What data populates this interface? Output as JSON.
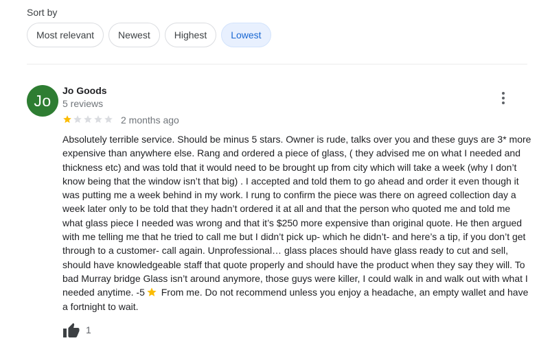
{
  "sort": {
    "label": "Sort by",
    "options": [
      "Most relevant",
      "Newest",
      "Highest",
      "Lowest"
    ],
    "selected": "Lowest"
  },
  "review": {
    "avatar_initials": "Jo",
    "author": "Jo Goods",
    "review_count": "5 reviews",
    "rating": 1,
    "rating_max": 5,
    "date": "2 months ago",
    "text_before_emoji": "Absolutely terrible service. Should be minus 5 stars. Owner is rude, talks over you and these guys are 3* more expensive than anywhere else. Rang and ordered a piece of glass, ( they advised me on what I needed and thickness etc) and was told that it would need to be brought up from city which will take a week (why I don’t know being that the window isn’t that big) . I accepted and told them to go ahead and order it even though it was putting me a week behind in my work. I rung to confirm the piece was there on agreed collection day a week later only to be told that they hadn’t ordered it at all and that the person who quoted me and told me what glass piece I needed was wrong and that it’s $250 more expensive than original quote. He then argued with me telling me that he tried to call me but I didn’t pick up- which he didn’t- and here’s a tip, if you don’t get through to a customer- call again.  Unprofessional… glass places should have glass ready to cut and sell, should have knowledgeable staff that quote properly and should have the product when they say they will. To bad Murray bridge Glass isn’t around anymore, those guys were killer, I could walk in and walk out with what I needed anytime. -5",
    "text_after_emoji": " From me. Do not recommend unless you enjoy a headache, an empty wallet and have a fortnight to wait.",
    "like_count": "1"
  },
  "colors": {
    "star_filled": "#fbbc04",
    "star_empty": "#dadce0",
    "avatar_bg": "#2e7d32",
    "selected_chip_bg": "#e8f0fe",
    "selected_chip_text": "#1967d2"
  },
  "icons": {
    "more": "more-vert-icon",
    "like": "thumb-up-icon",
    "inline_emoji": "star-emoji-icon"
  }
}
